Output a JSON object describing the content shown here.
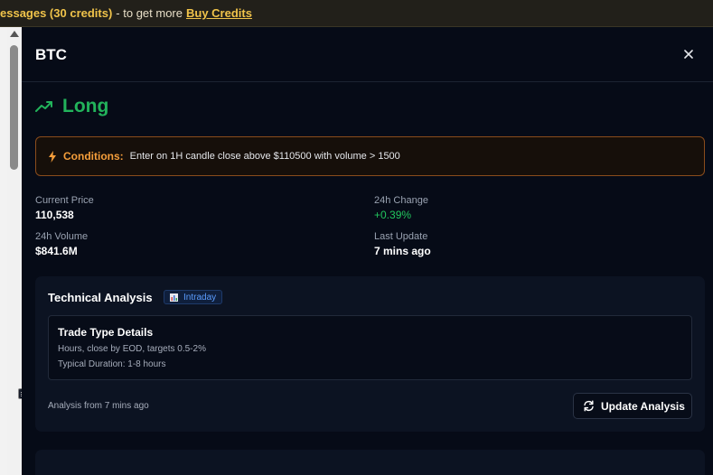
{
  "banner": {
    "credits_text": "essages (30 credits)",
    "middle_text": "- to get more",
    "link_label": "Buy Credits"
  },
  "panel": {
    "title": "BTC",
    "direction": "Long",
    "conditions": {
      "label": "Conditions:",
      "text": "Enter on 1H candle close above $110500 with volume > 1500"
    },
    "stats": {
      "current_price": {
        "label": "Current Price",
        "value": "110,538"
      },
      "change_24h": {
        "label": "24h Change",
        "value": "+0.39%"
      },
      "volume_24h": {
        "label": "24h Volume",
        "value": "$841.6M"
      },
      "last_update": {
        "label": "Last Update",
        "value": "7 mins ago"
      }
    },
    "technical_analysis": {
      "title": "Technical Analysis",
      "badge": "Intraday",
      "details": {
        "title": "Trade Type Details",
        "line1": "Hours, close by EOD, targets 0.5-2%",
        "line2": "Typical Duration: 1-8 hours"
      },
      "footer": "Analysis from 7 mins ago",
      "update_button": "Update Analysis"
    }
  },
  "colors": {
    "long_green": "#22b35b",
    "conditions_orange": "#f59e3b",
    "banner_gold": "#f0c34a",
    "badge_blue": "#5b9dff"
  },
  "icons": {
    "close": "close-icon",
    "direction": "trending-up-icon",
    "conditions": "lightning-icon",
    "badge": "bar-chart-icon",
    "update": "refresh-icon"
  }
}
